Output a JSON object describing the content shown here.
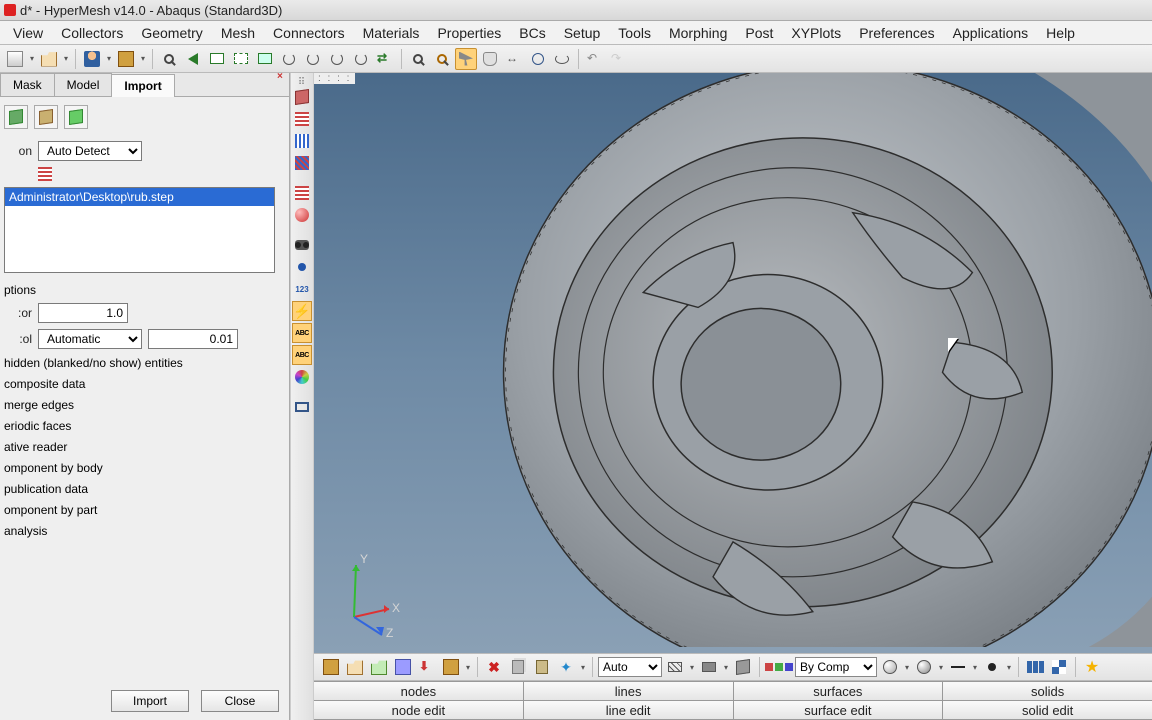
{
  "title": "d* - HyperMesh v14.0 - Abaqus (Standard3D)",
  "menu": [
    "View",
    "Collectors",
    "Geometry",
    "Mesh",
    "Connectors",
    "Materials",
    "Properties",
    "BCs",
    "Setup",
    "Tools",
    "Morphing",
    "Post",
    "XYPlots",
    "Preferences",
    "Applications",
    "Help"
  ],
  "left_panel": {
    "tabs": [
      "Mask",
      "Model",
      "Import"
    ],
    "active_tab": 2,
    "detect_label": "on",
    "detect_value": "Auto Detect",
    "file_selected": "Administrator\\Desktop\\rub.step",
    "options_label": "ptions",
    "scale_label": "or:",
    "scale_value": "1.0",
    "tol_label": "ol:",
    "tol_mode": "Automatic",
    "tol_value": "0.01",
    "checks": [
      "hidden (blanked/no show) entities",
      "composite data",
      "merge edges",
      "eriodic faces",
      "ative reader",
      "omponent by body",
      "publication data",
      "omponent by part",
      "analysis"
    ],
    "buttons": {
      "import": "Import",
      "close": "Close"
    }
  },
  "bottom_toolbar": {
    "auto": "Auto",
    "by_comp": "By Comp"
  },
  "panel_rows": {
    "row1": [
      "nodes",
      "lines",
      "surfaces",
      "solids"
    ],
    "row2": [
      "node edit",
      "line edit",
      "surface edit",
      "solid edit"
    ]
  },
  "triad": {
    "x": "X",
    "y": "Y",
    "z": "Z"
  }
}
